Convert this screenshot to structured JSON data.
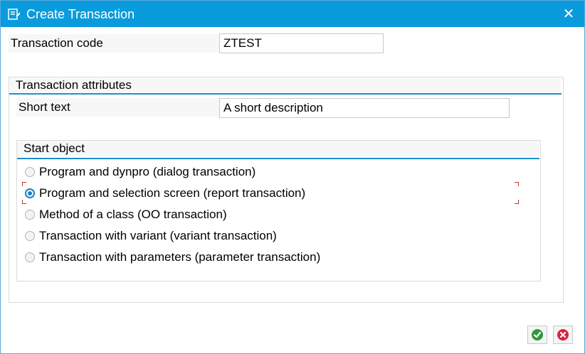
{
  "window": {
    "title": "Create Transaction"
  },
  "fields": {
    "transaction_code_label": "Transaction code",
    "transaction_code_value": "ZTEST"
  },
  "attributes": {
    "group_title": "Transaction attributes",
    "short_text_label": "Short text",
    "short_text_value": "A short description"
  },
  "start_object": {
    "group_title": "Start object",
    "options": [
      {
        "label": "Program and dynpro (dialog transaction)",
        "selected": false
      },
      {
        "label": "Program and selection screen (report transaction)",
        "selected": true
      },
      {
        "label": "Method of a class (OO transaction)",
        "selected": false
      },
      {
        "label": "Transaction with variant (variant transaction)",
        "selected": false
      },
      {
        "label": "Transaction with parameters (parameter transaction)",
        "selected": false
      }
    ]
  },
  "icons": {
    "title": "transaction-form-icon",
    "close": "close-icon",
    "confirm": "checkmark-icon",
    "cancel": "cancel-icon"
  },
  "colors": {
    "titlebar": "#0a9bdd",
    "accent_rule": "#1c8ecf",
    "confirm_green": "#2e9a3b",
    "cancel_red": "#d7263d",
    "focus_corner": "#c0392b"
  }
}
